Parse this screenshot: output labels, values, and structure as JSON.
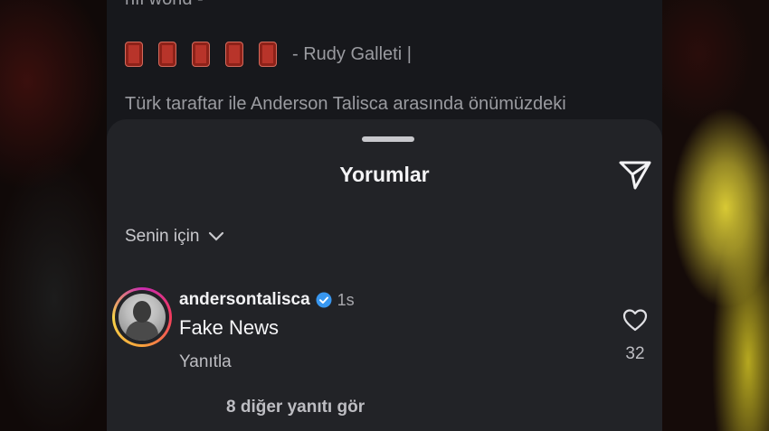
{
  "post": {
    "cut_line": "nfl world -",
    "author": "- Rudy Galleti |",
    "text_line": "Türk taraftar ile Anderson Talisca arasında önümüzdeki"
  },
  "sheet": {
    "title": "Yorumlar",
    "filter_label": "Senin için"
  },
  "comment": {
    "username": "andersontalisca",
    "time": "1s",
    "text": "Fake News",
    "reply_label": "Yanıtla",
    "like_count": "32",
    "more_replies": "8 diğer yanıtı gör"
  },
  "icons": {
    "send": "send-icon",
    "chevron": "chevron-down-icon",
    "verified": "verified-badge-icon",
    "like": "heart-icon"
  },
  "colors": {
    "sheet_bg": "#222327",
    "verified_blue": "#3897f0"
  }
}
